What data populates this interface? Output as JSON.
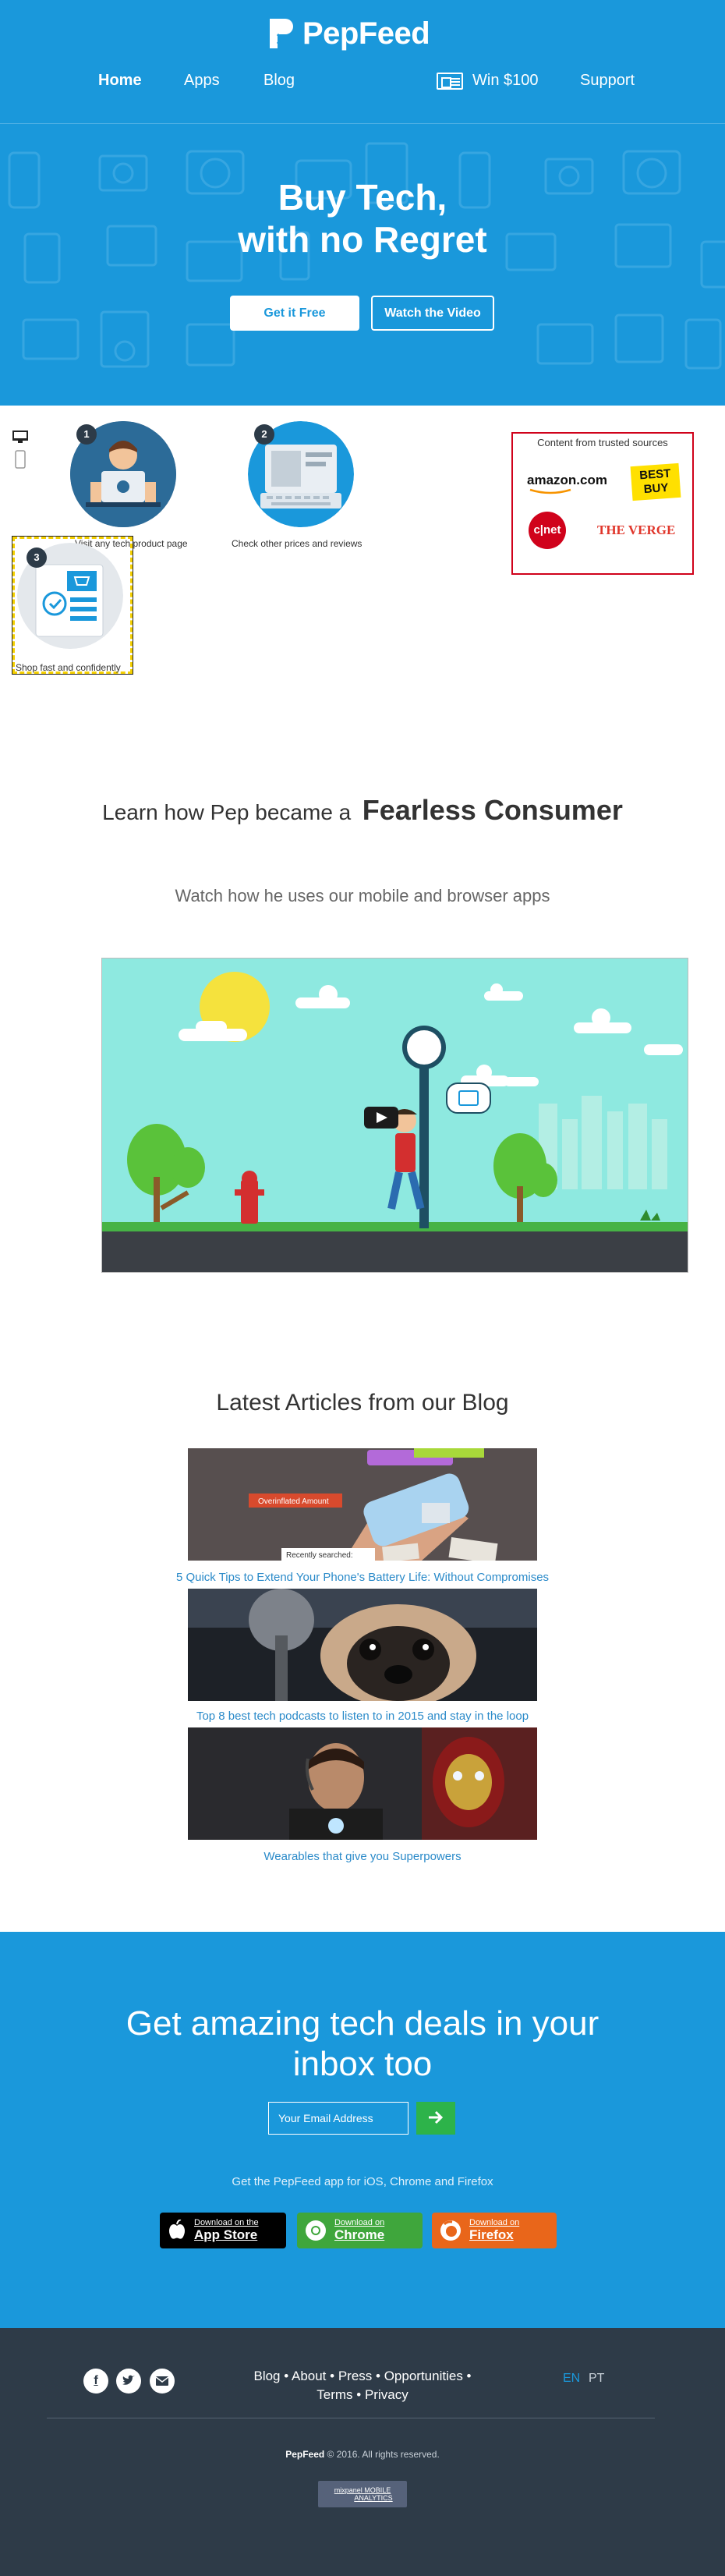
{
  "brand": {
    "name": "PepFeed"
  },
  "nav": {
    "home": "Home",
    "apps": "Apps",
    "blog": "Blog",
    "win": "Win $100",
    "support": "Support"
  },
  "hero": {
    "title_line1": "Buy Tech,",
    "title_line2": "with no Regret",
    "cta_free": "Get it Free",
    "cta_video": "Watch the Video"
  },
  "steps": [
    {
      "num": "1",
      "label": "Visit any tech product page"
    },
    {
      "num": "2",
      "label": "Check other prices and reviews"
    },
    {
      "num": "3",
      "label": "Shop fast and confidently"
    }
  ],
  "trusted": {
    "title": "Content from trusted sources",
    "logos": [
      "amazon.com",
      "BEST BUY",
      "c|net",
      "THE VERGE"
    ]
  },
  "learn": {
    "title_a": "Learn how Pep became a",
    "title_b": "Fearless Consumer",
    "subtitle": "Watch how he uses our mobile and browser apps"
  },
  "blog": {
    "title": "Latest Articles from our Blog",
    "articles": [
      {
        "title": "5 Quick Tips to Extend Your Phone's Battery Life: Without Compromises",
        "img_badge": "Overinflated Amount",
        "img_caption": "Recently searched:"
      },
      {
        "title": "Top 8 best tech podcasts to listen to in 2015 and stay in the loop"
      },
      {
        "title": "Wearables that give you Superpowers"
      }
    ]
  },
  "newsletter": {
    "title_line1": "Get amazing tech deals in your",
    "title_line2": "inbox too",
    "email_placeholder": "Your Email Address",
    "apps_text": "Get the PepFeed app for iOS, Chrome and Firefox",
    "stores": [
      {
        "small": "Download on the",
        "big": "App Store",
        "color": "#000000"
      },
      {
        "small": "Download on",
        "big": "Chrome",
        "color": "#3fa63c"
      },
      {
        "small": "Download on",
        "big": "Firefox",
        "color": "#e9661a"
      }
    ]
  },
  "footer": {
    "links_line1": [
      "Blog",
      "About",
      "Press",
      "Opportunities"
    ],
    "links_line2": [
      "Terms",
      "Privacy"
    ],
    "lang_en": "EN",
    "lang_pt": "PT",
    "copyright_brand": "PepFeed",
    "copyright_text": "© 2016. All rights reserved.",
    "badge_top": "mixpanel MOBILE",
    "badge_bottom": "ANALYTICS"
  },
  "colors": {
    "primary": "#1a98db",
    "dark": "#2e3b48",
    "link": "#2a8ac9",
    "accent_green": "#2db34a"
  }
}
